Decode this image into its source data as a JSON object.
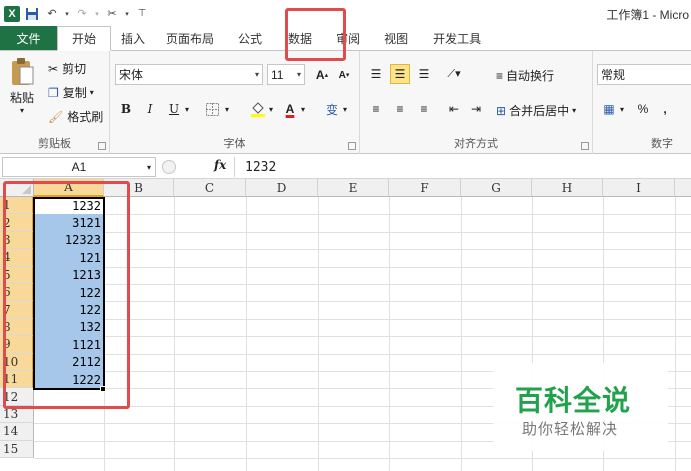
{
  "window": {
    "title": "工作簿1 - Micro"
  },
  "tabs": [
    "文件",
    "开始",
    "插入",
    "页面布局",
    "公式",
    "数据",
    "审阅",
    "视图",
    "开发工具"
  ],
  "clipboard": {
    "label": "剪贴板",
    "paste": "粘贴",
    "cut": "剪切",
    "copy": "复制",
    "format_painter": "格式刷"
  },
  "font": {
    "label": "字体",
    "name": "宋体",
    "size": "11",
    "bold": "B",
    "italic": "I",
    "underline": "U",
    "grow": "A",
    "shrink": "A",
    "phonetic": "变"
  },
  "alignment": {
    "label": "对齐方式",
    "wrap": "自动换行",
    "merge": "合并后居中"
  },
  "number": {
    "label": "数字",
    "format": "常规",
    "percent": "%",
    "comma": ","
  },
  "formula_bar": {
    "name_box": "A1",
    "fx": "fx",
    "content": "1232"
  },
  "columns": [
    "A",
    "B",
    "C",
    "D",
    "E",
    "F",
    "G",
    "H",
    "I"
  ],
  "rows": [
    "1",
    "2",
    "3",
    "4",
    "5",
    "6",
    "7",
    "8",
    "9",
    "10",
    "11",
    "12",
    "13",
    "14",
    "15"
  ],
  "cells_a": [
    "1232",
    "3121",
    "12323",
    "121",
    "1213",
    "122",
    "122",
    "132",
    "1121",
    "2112",
    "1222"
  ],
  "watermark": {
    "title": "百科全说",
    "subtitle": "助你轻松解决"
  },
  "colors": {
    "file_tab": "#1f7244",
    "highlight": "#e14b4b",
    "selection": "#a7c7ea",
    "header_active": "#f9d99a",
    "watermark": "#23a24d"
  }
}
